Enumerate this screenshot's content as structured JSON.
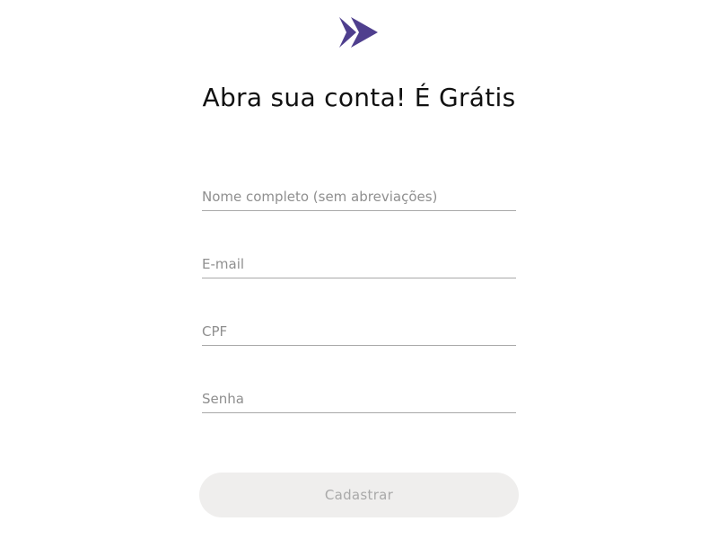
{
  "logo": {
    "icon": "double-chevron-right-icon",
    "color": "#4f3f8e"
  },
  "header": {
    "title": "Abra sua conta! É Grátis"
  },
  "form": {
    "fields": [
      {
        "name": "full-name",
        "placeholder": "Nome completo (sem abreviações)",
        "value": ""
      },
      {
        "name": "email",
        "placeholder": "E-mail",
        "value": ""
      },
      {
        "name": "cpf",
        "placeholder": "CPF",
        "value": ""
      },
      {
        "name": "password",
        "placeholder": "Senha",
        "value": ""
      }
    ],
    "submit_label": "Cadastrar",
    "submit_state": "disabled"
  },
  "colors": {
    "brand": "#4f3f8e",
    "button_bg": "#efeeed",
    "button_text": "#a9a9a9",
    "underline": "#a9a9a9",
    "placeholder": "#8f8f8f"
  }
}
